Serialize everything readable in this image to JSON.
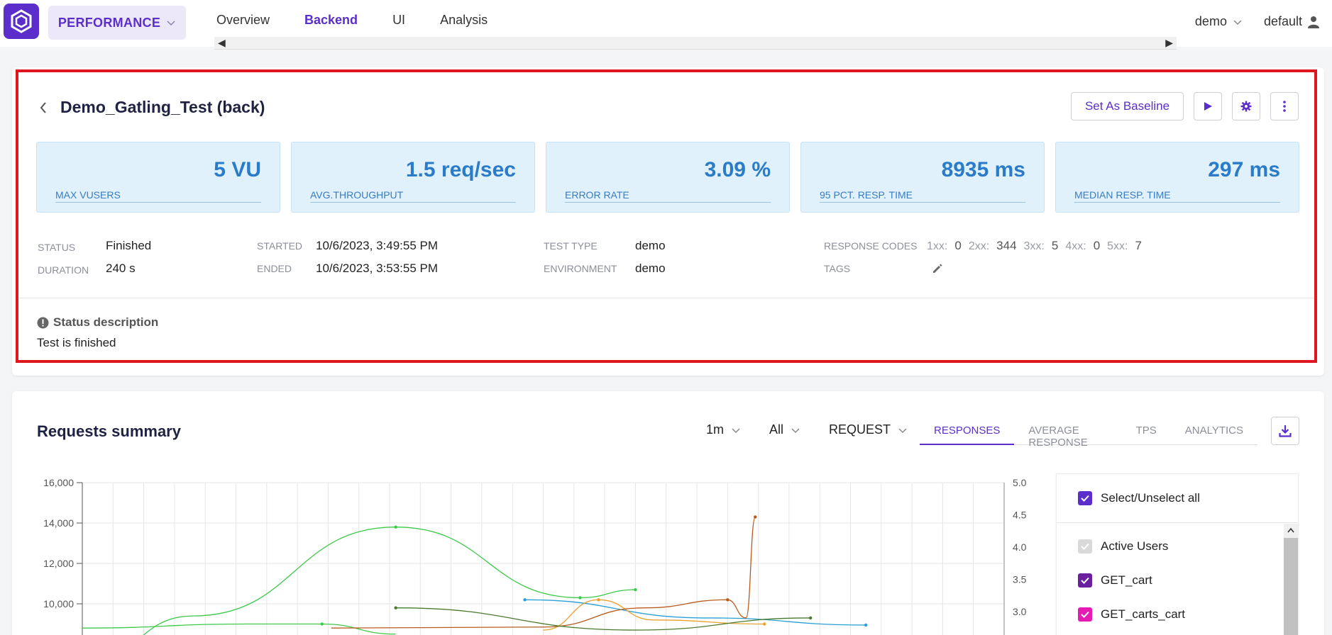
{
  "header": {
    "module": "PERFORMANCE",
    "nav": [
      "Overview",
      "Backend",
      "UI",
      "Analysis"
    ],
    "nav_active": "Backend",
    "project": "demo",
    "user": "default"
  },
  "test": {
    "title": "Demo_Gatling_Test (back)",
    "baseline_button": "Set As Baseline"
  },
  "metrics": [
    {
      "value": "5 VU",
      "label": "MAX VUSERS"
    },
    {
      "value": "1.5 req/sec",
      "label": "AVG.THROUGHPUT"
    },
    {
      "value": "3.09 %",
      "label": "ERROR RATE"
    },
    {
      "value": "8935 ms",
      "label": "95 PCT. RESP. TIME"
    },
    {
      "value": "297 ms",
      "label": "MEDIAN RESP. TIME"
    }
  ],
  "info": {
    "status_label": "STATUS",
    "status": "Finished",
    "duration_label": "DURATION",
    "duration": "240 s",
    "started_label": "STARTED",
    "started": "10/6/2023, 3:49:55 PM",
    "ended_label": "ENDED",
    "ended": "10/6/2023, 3:53:55 PM",
    "test_type_label": "TEST TYPE",
    "test_type": "demo",
    "environment_label": "ENVIRONMENT",
    "environment": "demo",
    "response_codes_label": "RESPONSE CODES",
    "tags_label": "TAGS",
    "response_codes": [
      {
        "key": "1xx:",
        "value": "0"
      },
      {
        "key": "2xx:",
        "value": "344"
      },
      {
        "key": "3xx:",
        "value": "5"
      },
      {
        "key": "4xx:",
        "value": "0"
      },
      {
        "key": "5xx:",
        "value": "7"
      }
    ]
  },
  "status_description": {
    "title": "Status description",
    "text": "Test is finished"
  },
  "requests_summary": {
    "title": "Requests summary",
    "interval": "1m",
    "filter": "All",
    "aggregation": "REQUEST",
    "tabs": [
      "RESPONSES",
      "AVERAGE RESPONSE",
      "TPS",
      "ANALYTICS"
    ],
    "active_tab": "RESPONSES"
  },
  "legend": {
    "select_all": "Select/Unselect all",
    "items": [
      {
        "label": "Active Users",
        "checked": true,
        "color": "#d9d9d9"
      },
      {
        "label": "GET_cart",
        "checked": true,
        "color": "#6a1f9e"
      },
      {
        "label": "GET_carts_cart",
        "checked": true,
        "color": "#e61bb3"
      }
    ]
  },
  "colors": {
    "accent": "#5b2ecc",
    "metric_value": "#2a7bc8",
    "highlight": "#e0161e"
  },
  "chart_data": {
    "type": "line",
    "y_left_ticks": [
      "16,000",
      "14,000",
      "12,000",
      "10,000"
    ],
    "y_right_ticks": [
      "5.0",
      "4.5",
      "4.0",
      "3.5",
      "3.0"
    ],
    "y_left_range": [
      8800,
      16000
    ],
    "y_right_range": [
      2.8,
      5.0
    ],
    "x_range": [
      0,
      1
    ],
    "series": [
      {
        "color": "#3ec94a",
        "x": [
          0.0,
          0.12,
          0.34,
          0.54,
          0.6
        ],
        "y": [
          7000,
          9400,
          13800,
          10300,
          10700
        ],
        "markers": [
          0.34,
          0.54,
          0.6
        ]
      },
      {
        "color": "#3ec94a",
        "x": [
          0.0,
          0.18,
          0.26,
          0.34
        ],
        "y": [
          8800,
          9000,
          9000,
          8500
        ],
        "markers": [
          0.26
        ]
      },
      {
        "color": "#2a9fd6",
        "x": [
          0.48,
          0.68,
          0.85
        ],
        "y": [
          10200,
          9300,
          8950
        ],
        "markers": [
          0.48,
          0.85
        ]
      },
      {
        "color": "#e8a030",
        "x": [
          0.5,
          0.56,
          0.62,
          0.74
        ],
        "y": [
          8700,
          10200,
          9200,
          9000
        ],
        "markers": [
          0.56,
          0.74
        ]
      },
      {
        "color": "#b85c1e",
        "x": [
          0.27,
          0.5,
          0.61,
          0.7,
          0.72,
          0.73
        ],
        "y": [
          8800,
          8850,
          9800,
          10200,
          9300,
          14300
        ],
        "markers": [
          0.7,
          0.73
        ]
      },
      {
        "color": "#4a7a2e",
        "x": [
          0.34,
          0.6,
          0.79
        ],
        "y": [
          9800,
          8700,
          9300
        ],
        "markers": [
          0.34,
          0.79
        ]
      }
    ]
  }
}
